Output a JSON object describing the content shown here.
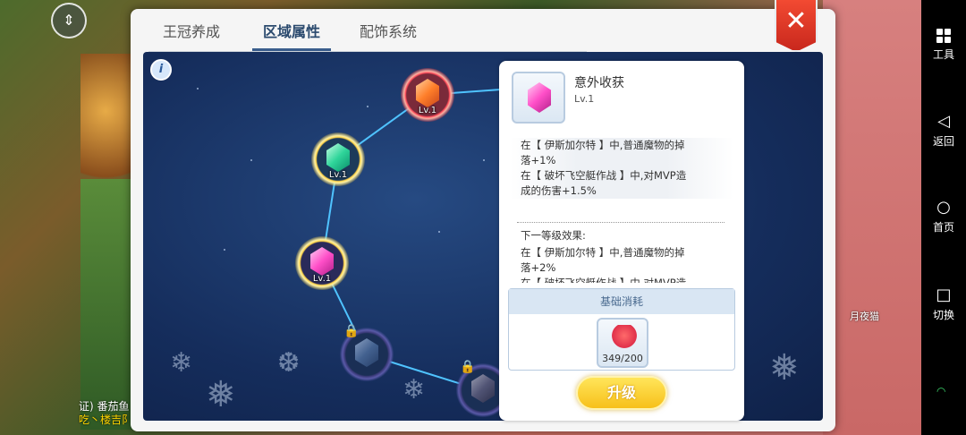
{
  "tabs": [
    {
      "label": "王冠养成",
      "active": false
    },
    {
      "label": "区域属性",
      "active": true
    },
    {
      "label": "配饰系统",
      "active": false
    }
  ],
  "close_label": "✕",
  "info_label": "i",
  "nodes": [
    {
      "level": "Lv.1",
      "color": "orange",
      "locked": false
    },
    {
      "level": "Lv.1",
      "color": "green",
      "locked": false
    },
    {
      "level": "Lv.1",
      "color": "pink",
      "locked": false
    },
    {
      "level": "",
      "color": "blue",
      "locked": true
    },
    {
      "level": "",
      "color": "dark",
      "locked": true
    }
  ],
  "detail": {
    "title": "意外收获",
    "level": "Lv.1",
    "current_effects": [
      "在【 伊斯加尔特 】中,普通魔物的掉",
      "落+1%",
      "在【 破坏飞空艇作战 】中,对MVP造",
      "成的伤害+1.5%"
    ],
    "next_title": "下一等级效果:",
    "next_effects": [
      "在【 伊斯加尔特 】中,普通魔物的掉",
      "落+2%",
      "在【 破坏飞空艇作战 】中,对MVP造"
    ],
    "cost_title": "基础消耗",
    "cost_count": "349/200",
    "upgrade_label": "升级"
  },
  "nav": {
    "tools": "工具",
    "back": "返回",
    "home": "首页",
    "switch": "切换"
  },
  "chat": {
    "line1": "证) 番茄鱼",
    "line2": "吃丶楼吉阝"
  },
  "moon_name": "月夜猫",
  "colors": {
    "accent": "#3a5d8c",
    "close": "#e23b2a",
    "upgrade": "#f7c01a"
  }
}
